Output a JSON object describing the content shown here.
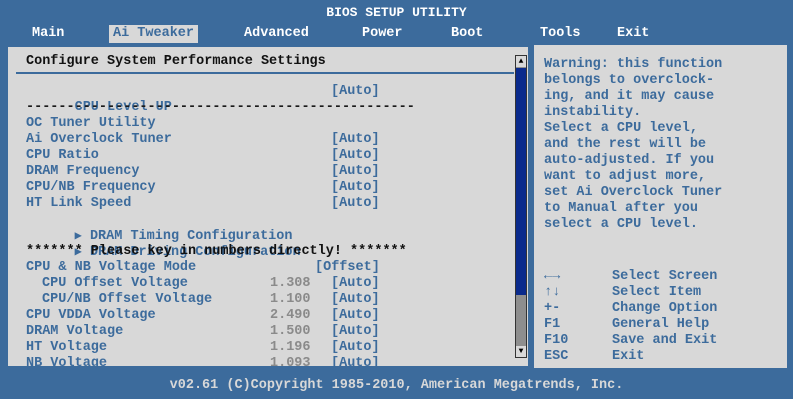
{
  "title": "BIOS SETUP UTILITY",
  "menu": [
    "Main",
    "Ai Tweaker",
    "Advanced",
    "Power",
    "Boot",
    "Tools",
    "Exit"
  ],
  "active_menu": "Ai Tweaker",
  "panel_heading": "Configure System Performance Settings",
  "rows": {
    "cpu_level_up": {
      "label": "CPU Level UP",
      "value": "[Auto]"
    },
    "separator": "------------------------------------------------",
    "oc_tuner": {
      "label": "OC Tuner Utility"
    },
    "ai_overclock_tuner": {
      "label": "Ai Overclock Tuner",
      "value": "[Auto]"
    },
    "cpu_ratio": {
      "label": "CPU Ratio",
      "value": "[Auto]"
    },
    "dram_frequency": {
      "label": "DRAM Frequency",
      "value": "[Auto]"
    },
    "cpu_nb_frequency": {
      "label": "CPU/NB Frequency",
      "value": "[Auto]"
    },
    "ht_link_speed": {
      "label": "HT Link Speed",
      "value": "[Auto]"
    },
    "dram_timing": {
      "label": "DRAM Timing Configuration"
    },
    "dram_driving": {
      "label": "DRAM Driving Configuration"
    },
    "key_note": "******* Please key in numbers directly! *******",
    "cpu_nb_voltage_mode": {
      "label": "CPU & NB Voltage Mode",
      "value": "[Offset]"
    },
    "cpu_offset_voltage": {
      "label": "CPU Offset Voltage",
      "number": "1.308",
      "value": "[Auto]"
    },
    "cpu_nb_offset_voltage": {
      "label": "CPU/NB Offset Voltage",
      "number": "1.100",
      "value": "[Auto]"
    },
    "cpu_vdda_voltage": {
      "label": "CPU VDDA Voltage",
      "number": "2.490",
      "value": "[Auto]"
    },
    "dram_voltage": {
      "label": "DRAM Voltage",
      "number": "1.500",
      "value": "[Auto]"
    },
    "ht_voltage": {
      "label": "HT Voltage",
      "number": "1.196",
      "value": "[Auto]"
    },
    "nb_voltage": {
      "label": "NB Voltage",
      "number": "1.093",
      "value": "[Auto]"
    }
  },
  "help_lines": [
    "Warning: this function",
    "belongs to overclock-",
    "ing, and it may cause",
    "instability.",
    "Select a CPU level,",
    "and the rest will be",
    "auto-adjusted. If you",
    "want to adjust more,",
    "set Ai Overclock Tuner",
    "to Manual after you",
    "select a CPU level."
  ],
  "keys": [
    {
      "key": "←→",
      "desc": "Select Screen"
    },
    {
      "key": "↑↓",
      "desc": "Select Item"
    },
    {
      "key": "+-",
      "desc": "Change Option"
    },
    {
      "key": "F1",
      "desc": "General Help"
    },
    {
      "key": "F10",
      "desc": "Save and Exit"
    },
    {
      "key": "ESC",
      "desc": "Exit"
    }
  ],
  "footer": "v02.61 (C)Copyright 1985-2010, American Megatrends, Inc.",
  "icons": {
    "submenu_arrow": "triangle-right-icon",
    "scroll_up": "arrow-up-icon",
    "scroll_down": "arrow-down-icon"
  },
  "colors": {
    "background": "#3c6b9c",
    "panel": "#d8d8d8",
    "highlight_text": "#3c6b9c",
    "scroll_thumb": "#0a2a8c"
  }
}
